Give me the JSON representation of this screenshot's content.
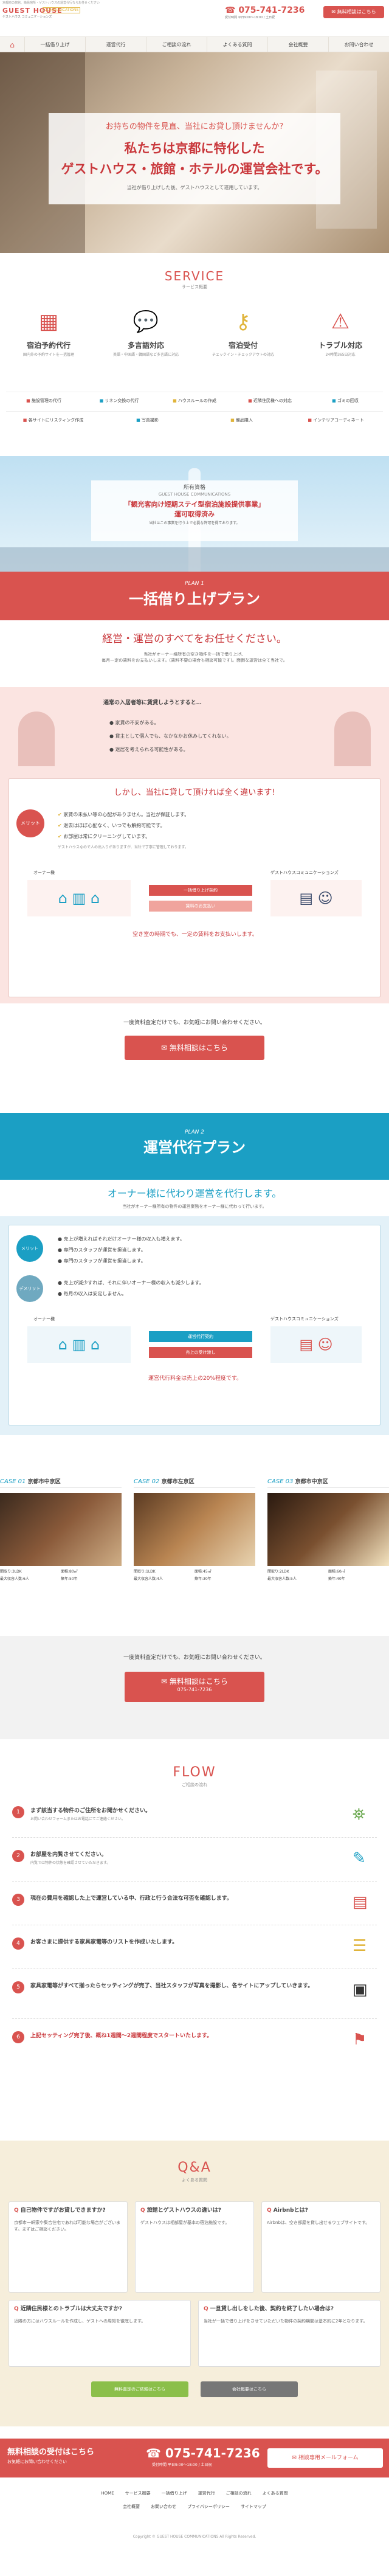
{
  "header": {
    "tagline": "京都府の旅館、簡易宿所・ゲストハウスの運営代行ならお任せください",
    "logo_main": "GUEST HOUSE",
    "logo_sub": "COMMUNICATIONS",
    "logo_jp": "ゲストハウス コミュニケーションズ",
    "phone": "075-741-7236",
    "hours": "受付時間 平日9:00〜18:00 / 土日祝",
    "contact_btn": "無料相談はこちら"
  },
  "nav": {
    "home": "⌂",
    "items": [
      "一括借り上げ",
      "運営代行",
      "ご相談の流れ",
      "よくある質問",
      "会社概要",
      "お問い合わせ"
    ]
  },
  "hero": {
    "line1": "お持ちの物件を見直、当社にお貸し頂けませんか?",
    "line2": "私たちは京都に特化した",
    "line3": "ゲストハウス・旅館・ホテルの運営会社です。",
    "line4": "当社が借り上げした後、ゲストハウスとして運用しています。"
  },
  "service": {
    "title": "SERVICE",
    "subtitle": "サービス概要",
    "items": [
      {
        "name": "宿泊予約代行",
        "desc": "国内外の予約サイトを一括管理"
      },
      {
        "name": "多言語対応",
        "desc": "英語・中国語・韓国語など多言語に対応"
      },
      {
        "name": "宿泊受付",
        "desc": "チェックイン・チェックアウトの対応"
      },
      {
        "name": "トラブル対応",
        "desc": "24時間365日対応"
      }
    ],
    "row1": [
      "施設管理の代行",
      "リネン交換の代行",
      "ハウスルールの作成",
      "近隣住民様への対応",
      "ゴミの回収"
    ],
    "row2": [
      "各サイトにリスティング作成",
      "写真撮影",
      "備品購入",
      "インテリアコーディネート"
    ]
  },
  "license": {
    "label": "所有資格",
    "company": "GUEST HOUSE COMMUNICATIONS",
    "line1": "「観光客向け短期ステイ型宿泊施設提供事業」",
    "line2": "運可取得済み",
    "small": "国内外の観光客様向けに、宿泊施設の運営を行っております。",
    "note": "当社はこの事業を行う上で必要な許可を得ております。"
  },
  "plan1": {
    "label": "PLAN 1",
    "title": "一括借り上げプラン",
    "lead": "経営・運営のすべてをお任せください。",
    "desc1": "当社がオーナー様所有の空き物件を一括で借り上げ、",
    "desc2": "毎月一定の賃料をお支払いします。(賃料不要の場合も相談可能です)。面倒な運営は全て当社で。",
    "worry_title": "通常の入居者等に賃貸しようとすると…",
    "worries": [
      "家賃の不安がある。",
      "貸主として個人でも、なかなかお休みしてくれない。",
      "退居を考えられる可能性がある。"
    ],
    "solution_title": "しかし、当社に貸して頂ければ全く違います!",
    "merit_label": "メリット",
    "merits": [
      "家賃の未払い等の心配がありません。当社が保証します。",
      "退去はほぼ心配なく、いつでも解約可能です。",
      "お部屋は常にクリーニングしています。"
    ],
    "merit_note": "ゲストハウスなので人の出入りがありますが、当社で丁寧に管理しております。",
    "owner": "オーナー様",
    "company_label": "ゲストハウスコミュニケーションズ",
    "arrow1": "一括借り上げ契約",
    "arrow2": "賃料のお支払い",
    "result": "空き室の時期でも、一定の賃料をお支払いします。",
    "cta_text": "一度資料査定だけでも、お気軽にお問い合わせください。",
    "cta_btn": "無料相談はこちら"
  },
  "plan2": {
    "label": "PLAN 2",
    "title": "運営代行プラン",
    "lead": "オーナー様に代わり運営を代行します。",
    "desc": "当社がオーナー様所有の物件の運営業務をオーナー様に代わって行います。",
    "merit_label": "メリット",
    "merits": [
      "売上が増えればそれだけオーナー様の収入も増えます。",
      "専門のスタッフが運営を担当します。",
      "専門のスタッフが運営を担当します。"
    ],
    "demerit_label": "デメリット",
    "demerits": [
      "売上が減少すれば、それに伴いオーナー様の収入も減少します。",
      "毎月の収入は安定しません。"
    ],
    "owner": "オーナー様",
    "company_label": "ゲストハウスコミュニケーションズ",
    "arrow1": "運営代行契約",
    "arrow2": "売上の受け渡し",
    "result": "運営代行料金は売上の20%程度です。",
    "cta_text": "一度資料査定だけでも、お気軽にお問い合わせください。",
    "cta_btn": "無料相談はこちら"
  },
  "cases": [
    {
      "label": "CASE 01",
      "title": "京都市中京区",
      "l1": "間取り:3LDK",
      "l2": "面積:80㎡",
      "l3": "最大収容人数:6人",
      "l4": "築年:50年"
    },
    {
      "label": "CASE 02",
      "title": "京都市左京区",
      "l1": "間取り:1LDK",
      "l2": "面積:45㎡",
      "l3": "最大収容人数:4人",
      "l4": "築年:30年"
    },
    {
      "label": "CASE 03",
      "title": "京都市中京区",
      "l1": "間取り:2LDK",
      "l2": "面積:60㎡",
      "l3": "最大収容人数:5人",
      "l4": "築年:40年"
    }
  ],
  "cta3": {
    "text": "一度資料査定だけでも、お気軽にお問い合わせください。",
    "btn": "無料相談はこちら",
    "btn_sub": "075-741-7236"
  },
  "flow": {
    "title": "FLOW",
    "subtitle": "ご相談の流れ",
    "steps": [
      "まず該当する物件のご住所をお聞かせください。",
      "お部屋を内覧させてください。",
      "現在の費用を確認した上で運営している中、行政と行う合法な可否を確認します。",
      "お客さまに提供する家具家電等のリストを作成いたします。",
      "家具家電等がすべて揃ったらセッティングが完了、当社スタッフが写真を撮影し、各サイトにアップしていきます。",
      "上記セッティング完了後、概ね1週間〜2週間程度でスタートいたします。"
    ],
    "notes": [
      "お問い合わせフォームまたはお電話にてご連絡ください。",
      "内覧では物件の状態を確認させていただきます。",
      "",
      "",
      "",
      ""
    ]
  },
  "qa": {
    "title": "Q&A",
    "subtitle": "よくある質問",
    "items": [
      {
        "q": "自己物件ですがお貸しできますか?",
        "a": "京都市一軒家や集合住宅であれば可能な場合がございます。まずはご相談ください。"
      },
      {
        "q": "旅館とゲストハウスの違いは?",
        "a": "ゲストハウスは相部屋が基本の宿泊施設です。"
      },
      {
        "q": "Airbnbとは?",
        "a": "Airbnbは、空き部屋を貸し出せるウェブサイトです。"
      },
      {
        "q": "近隣住民様とのトラブルは大丈夫ですか?",
        "a": "近隣の方にはハウスルールを作成し、ゲストへの周知を徹底します。"
      },
      {
        "q": "一旦貸し出しをした後、契約を終了したい場合は?",
        "a": "当社が一括で借り上げをさせていただいた物件の契約期間は基本的に2年となります。"
      }
    ],
    "btn1": "無料査定のご依頼はこちら",
    "btn2": "会社概要はこちら"
  },
  "footer_bar": {
    "title": "無料相談の受付はこちら",
    "sub": "お気軽にお問い合わせください",
    "phone": "075-741-7236",
    "hours": "受付時間 平日9:00〜18:00 / 土日祝",
    "mail_btn": "相談専用メールフォーム"
  },
  "footer": {
    "links1": [
      "HOME",
      "サービス概要",
      "一括借り上げ",
      "運営代行",
      "ご相談の流れ",
      "よくある質問"
    ],
    "links2": [
      "会社概要",
      "お問い合わせ",
      "プライバシーポリシー",
      "サイトマップ"
    ],
    "copyright": "Copyright © GUEST HOUSE COMMUNICATIONS All Rights Reserved."
  },
  "colors": {
    "accent": "#d9534f",
    "dark": "#c9373b",
    "teal": "#1b9fc4",
    "pink": "#fbe4e1",
    "gold": "#e0b43a"
  }
}
